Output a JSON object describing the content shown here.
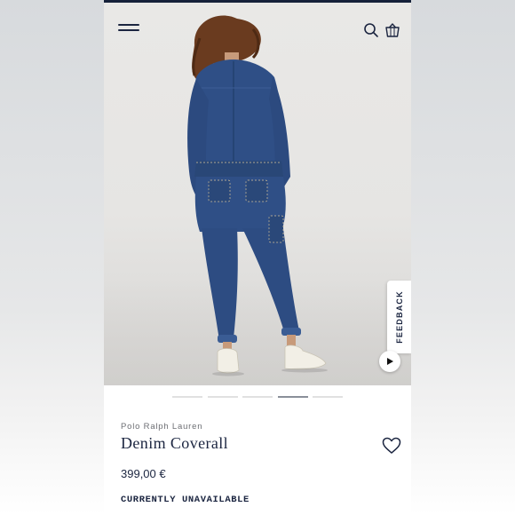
{
  "header": {
    "menu_icon": "hamburger-menu-icon",
    "search_icon": "search-icon",
    "bag_icon": "shopping-bag-icon"
  },
  "gallery": {
    "image_count": 5,
    "active_index": 3,
    "feedback_label": "FEEDBACK",
    "play_icon": "play-icon"
  },
  "product": {
    "brand": "Polo Ralph Lauren",
    "name": "Denim Coverall",
    "price": "399,00 €",
    "availability": "CURRENTLY UNAVAILABLE",
    "wishlist_icon": "heart-icon"
  },
  "colors": {
    "navy": "#1b2540",
    "denim": "#2f4f86",
    "background": "#e7e6e4"
  }
}
